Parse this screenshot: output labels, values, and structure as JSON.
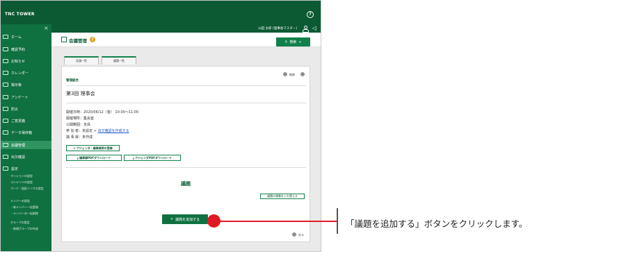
{
  "app": {
    "logo": "TNC TOWER"
  },
  "user": {
    "name": "山田 太郎 [理事長マスター]"
  },
  "sidebar": {
    "close": "×",
    "items": [
      {
        "label": "ホーム",
        "icon": "home-icon"
      },
      {
        "label": "確認予約",
        "icon": "clock-icon"
      },
      {
        "label": "お知らせ",
        "icon": "info-icon"
      },
      {
        "label": "カレンダー",
        "icon": "calendar-icon"
      },
      {
        "label": "掲示板",
        "icon": "board-icon"
      },
      {
        "label": "アンケート",
        "icon": "survey-icon"
      },
      {
        "label": "防災",
        "icon": "shield-icon"
      },
      {
        "label": "ご意見箱",
        "icon": "opinion-icon"
      },
      {
        "label": "データ保存箱",
        "icon": "data-icon"
      },
      {
        "label": "会議管理",
        "icon": "meeting-icon",
        "active": true
      },
      {
        "label": "出欠確認",
        "icon": "attendance-icon"
      },
      {
        "label": "設定",
        "icon": "settings-icon"
      }
    ],
    "sub_items": [
      "マンションの設定",
      "コンテンツの設定",
      "パーツ・認証リンクの設定",
      "メンバーの設定",
      "・新メンバー一括登録",
      "・メンバーの一括削除",
      "グループの設定",
      "・新規グループの作成"
    ]
  },
  "page": {
    "title": "会議管理",
    "help": "?",
    "search_label": "検索",
    "search_plus": "+",
    "tabs": [
      "会議一覧",
      "議題一覧"
    ],
    "edit_label": "編集",
    "subhead": "管理組合",
    "meeting_title": "第3回 理事会",
    "info": {
      "datetime": "開催日時：2020/06/12（金） 10:00～11:00",
      "place": "開催場所：集会室",
      "scope": "公開範囲：全員",
      "attendees_prefix": "参 加 者：未設定 > ",
      "attendees_link": "出欠確認を作成する",
      "minutes": "議 事 録：未作成"
    },
    "agenda_btn": "> アジェンダ・議事録表の登録",
    "pdf_btn_1": "議事録PDFダウンロード",
    "pdf_btn_2": "アジェンダPDFダウンロード",
    "section_title": "議題",
    "swap_btn": "議題の順番を入れ替える",
    "add_btn": "議題を追加する",
    "add_plus": "+",
    "back_label": "戻る"
  },
  "callout": {
    "text": "「議題を追加する」ボタンをクリックします。"
  },
  "colors": {
    "brand_dark": "#0b5a34",
    "brand": "#0f7040",
    "accent_red": "#e01a22"
  }
}
